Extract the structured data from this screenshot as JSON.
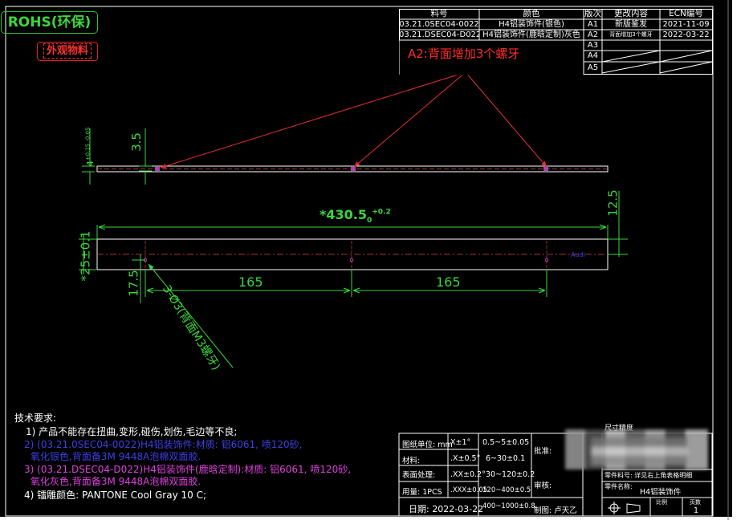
{
  "badges": {
    "rohs": "ROHS(环保)",
    "appearance": "外观物料"
  },
  "revision_table": {
    "headers": [
      "料号",
      "颜色",
      "版次",
      "更改内容",
      "ECN编号"
    ],
    "parts": [
      {
        "part_no": "03.21.0SEC04-0022",
        "color": "H4铝装饰件(银色)"
      },
      {
        "part_no": "03.21.DSEC04-D022",
        "color": "H4铝装饰件(鹿晗定制)灰色"
      }
    ],
    "revisions": [
      {
        "version": "A1",
        "change": "新版鉴发",
        "ecn": "2021-11-09"
      },
      {
        "version": "A2",
        "change": "背面增加3个螺牙",
        "ecn": "2022-03-22"
      },
      {
        "version": "A3",
        "change": "",
        "ecn": ""
      },
      {
        "version": "A4",
        "change": "",
        "ecn": ""
      },
      {
        "version": "A5",
        "change": "",
        "ecn": ""
      }
    ]
  },
  "annotations": {
    "a2_note": "A2:背面增加3个螺牙"
  },
  "side_view": {
    "thickness_dim": "4",
    "thickness_tol": "+0.15 -0.05",
    "height_dim": "3.5"
  },
  "plan_view": {
    "length_dim": "*430.5",
    "length_tol_lower": "0",
    "length_tol_upper": "+0.2",
    "edge_offset_dim": "12.5",
    "width_dim": "*25±0.1",
    "hole_offset_dim": "17.5",
    "pitch_left": "165",
    "pitch_right": "165",
    "hole_callout": "3-Ø3(背面M3螺牙)",
    "end_mark": "Audi"
  },
  "notes": {
    "title": "技术要求:",
    "items": [
      "1) 产品不能存在扭曲,变形,碰伤,划伤,毛边等不良;",
      "2) (03.21.0SEC04-0022)H4铝装饰件:材质: 铝6061, 喷120砂,",
      "氧化银色,背面备3M 9448A泡棉双面胶.",
      "3) (03.21.DSEC04-D022)H4铝装饰件(鹿晗定制):材质: 铝6061, 喷120砂,",
      "氧化灰色,背面备3M 9448A泡棉双面胶.",
      "4) 镭雕颜色: PANTONE Cool Gray 10 C;"
    ]
  },
  "title_block": {
    "unit": "图纸单位: mm",
    "material": "材料:",
    "surface": "表面处理:",
    "quantity": "用量: 1PCS",
    "tolerances": [
      "X±1°",
      ".X±0.5°",
      ".XX±0.2°",
      ".XXX±0.05"
    ],
    "ranges": [
      "0.5~5±0.05",
      "6~30±0.1",
      "30~120±0.2",
      "120~400±0.5",
      "400~1000±0.8"
    ],
    "approved": "批准:",
    "reviewed": "审核:",
    "drafter": "制图: 卢天乙",
    "date": "日期: 2022-03-22",
    "part_no_label": "零件料号: 详见右上角表格明细",
    "part_name_label": "零件名称:",
    "part_name": "H4铝装饰件",
    "scale_label": "比例",
    "page_label": "页数",
    "page_number": "1",
    "unnoted_dims": "尺寸精度"
  }
}
